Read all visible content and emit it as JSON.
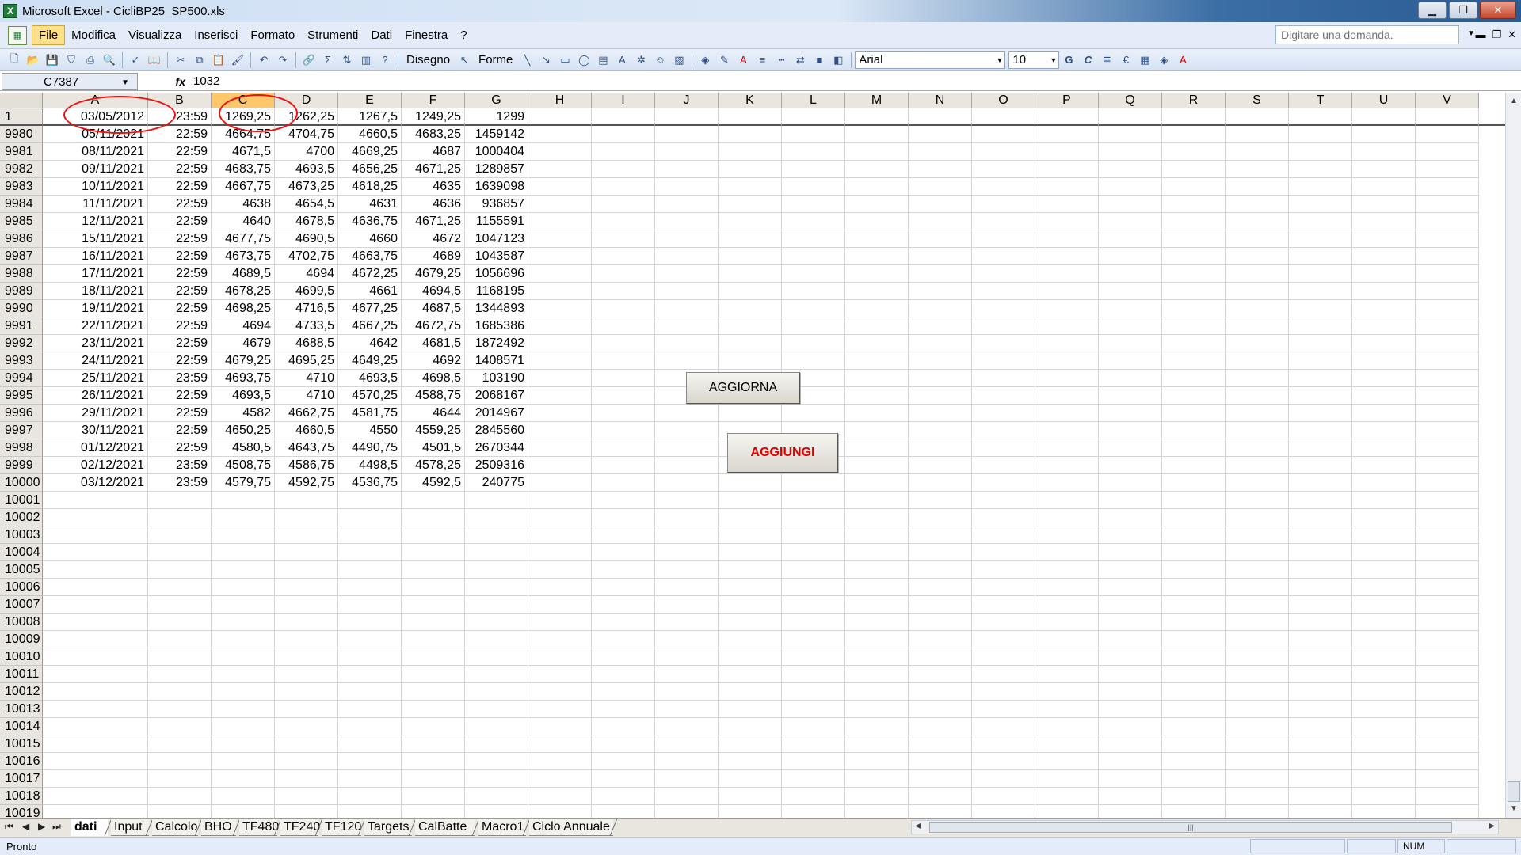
{
  "window": {
    "title": "Microsoft Excel - CicliBP25_SP500.xls",
    "app_icon": "excel-icon"
  },
  "menu": [
    "File",
    "Modifica",
    "Visualizza",
    "Inserisci",
    "Formato",
    "Strumenti",
    "Dati",
    "Finestra",
    "?"
  ],
  "help": {
    "placeholder": "Digitare una domanda."
  },
  "toolbar": {
    "disegno_label": "Disegno",
    "forme_label": "Forme",
    "font_name": "Arial",
    "font_size": "10",
    "bold_label": "G",
    "italic_label": "C",
    "euro_label": "€"
  },
  "formula": {
    "name_box": "C7387",
    "fx_label": "fx",
    "value": "1032"
  },
  "columns": [
    "A",
    "B",
    "C",
    "D",
    "E",
    "F",
    "G",
    "H",
    "I",
    "J",
    "K",
    "L",
    "M",
    "N",
    "O",
    "P",
    "Q",
    "R",
    "S",
    "T",
    "U",
    "V"
  ],
  "selected_column": "C",
  "rows": [
    {
      "n": "1",
      "cells": [
        "03/05/2012",
        "23:59",
        "1269,25",
        "1262,25",
        "1267,5",
        "1249,25",
        "1299"
      ]
    },
    {
      "n": "9980",
      "cells": [
        "05/11/2021",
        "22:59",
        "4664,75",
        "4704,75",
        "4660,5",
        "4683,25",
        "1459142"
      ]
    },
    {
      "n": "9981",
      "cells": [
        "08/11/2021",
        "22:59",
        "4671,5",
        "4700",
        "4669,25",
        "4687",
        "1000404"
      ]
    },
    {
      "n": "9982",
      "cells": [
        "09/11/2021",
        "22:59",
        "4683,75",
        "4693,5",
        "4656,25",
        "4671,25",
        "1289857"
      ]
    },
    {
      "n": "9983",
      "cells": [
        "10/11/2021",
        "22:59",
        "4667,75",
        "4673,25",
        "4618,25",
        "4635",
        "1639098"
      ]
    },
    {
      "n": "9984",
      "cells": [
        "11/11/2021",
        "22:59",
        "4638",
        "4654,5",
        "4631",
        "4636",
        "936857"
      ]
    },
    {
      "n": "9985",
      "cells": [
        "12/11/2021",
        "22:59",
        "4640",
        "4678,5",
        "4636,75",
        "4671,25",
        "1155591"
      ]
    },
    {
      "n": "9986",
      "cells": [
        "15/11/2021",
        "22:59",
        "4677,75",
        "4690,5",
        "4660",
        "4672",
        "1047123"
      ]
    },
    {
      "n": "9987",
      "cells": [
        "16/11/2021",
        "22:59",
        "4673,75",
        "4702,75",
        "4663,75",
        "4689",
        "1043587"
      ]
    },
    {
      "n": "9988",
      "cells": [
        "17/11/2021",
        "22:59",
        "4689,5",
        "4694",
        "4672,25",
        "4679,25",
        "1056696"
      ]
    },
    {
      "n": "9989",
      "cells": [
        "18/11/2021",
        "22:59",
        "4678,25",
        "4699,5",
        "4661",
        "4694,5",
        "1168195"
      ]
    },
    {
      "n": "9990",
      "cells": [
        "19/11/2021",
        "22:59",
        "4698,25",
        "4716,5",
        "4677,25",
        "4687,5",
        "1344893"
      ]
    },
    {
      "n": "9991",
      "cells": [
        "22/11/2021",
        "22:59",
        "4694",
        "4733,5",
        "4667,25",
        "4672,75",
        "1685386"
      ]
    },
    {
      "n": "9992",
      "cells": [
        "23/11/2021",
        "22:59",
        "4679",
        "4688,5",
        "4642",
        "4681,5",
        "1872492"
      ]
    },
    {
      "n": "9993",
      "cells": [
        "24/11/2021",
        "22:59",
        "4679,25",
        "4695,25",
        "4649,25",
        "4692",
        "1408571"
      ]
    },
    {
      "n": "9994",
      "cells": [
        "25/11/2021",
        "23:59",
        "4693,75",
        "4710",
        "4693,5",
        "4698,5",
        "103190"
      ]
    },
    {
      "n": "9995",
      "cells": [
        "26/11/2021",
        "22:59",
        "4693,5",
        "4710",
        "4570,25",
        "4588,75",
        "2068167"
      ]
    },
    {
      "n": "9996",
      "cells": [
        "29/11/2021",
        "22:59",
        "4582",
        "4662,75",
        "4581,75",
        "4644",
        "2014967"
      ]
    },
    {
      "n": "9997",
      "cells": [
        "30/11/2021",
        "22:59",
        "4650,25",
        "4660,5",
        "4550",
        "4559,25",
        "2845560"
      ]
    },
    {
      "n": "9998",
      "cells": [
        "01/12/2021",
        "22:59",
        "4580,5",
        "4643,75",
        "4490,75",
        "4501,5",
        "2670344"
      ]
    },
    {
      "n": "9999",
      "cells": [
        "02/12/2021",
        "23:59",
        "4508,75",
        "4586,75",
        "4498,5",
        "4578,25",
        "2509316"
      ]
    },
    {
      "n": "10000",
      "cells": [
        "03/12/2021",
        "23:59",
        "4579,75",
        "4592,75",
        "4536,75",
        "4592,5",
        "240775"
      ]
    },
    {
      "n": "10001",
      "cells": []
    },
    {
      "n": "10002",
      "cells": []
    },
    {
      "n": "10003",
      "cells": []
    },
    {
      "n": "10004",
      "cells": []
    },
    {
      "n": "10005",
      "cells": []
    },
    {
      "n": "10006",
      "cells": []
    },
    {
      "n": "10007",
      "cells": []
    },
    {
      "n": "10008",
      "cells": []
    },
    {
      "n": "10009",
      "cells": []
    },
    {
      "n": "10010",
      "cells": []
    },
    {
      "n": "10011",
      "cells": []
    },
    {
      "n": "10012",
      "cells": []
    },
    {
      "n": "10013",
      "cells": []
    },
    {
      "n": "10014",
      "cells": []
    },
    {
      "n": "10015",
      "cells": []
    },
    {
      "n": "10016",
      "cells": []
    },
    {
      "n": "10017",
      "cells": []
    },
    {
      "n": "10018",
      "cells": []
    },
    {
      "n": "10019",
      "cells": []
    }
  ],
  "buttons": {
    "aggiorna": "AGGIORNA",
    "aggiungi": "AGGIUNGI"
  },
  "sheet_tabs": [
    "dati",
    "Input",
    "Calcolo",
    "BHO",
    "TF480",
    "TF240",
    "TF120",
    "Targets",
    "CalBatte",
    "Macro1",
    "Ciclo Annuale"
  ],
  "active_tab": "dati",
  "status": {
    "text": "Pronto",
    "num": "NUM"
  },
  "colors": {
    "annotation": "#e11111",
    "selected_header": "#ffc76a",
    "aggiungi_text": "#e00000"
  }
}
